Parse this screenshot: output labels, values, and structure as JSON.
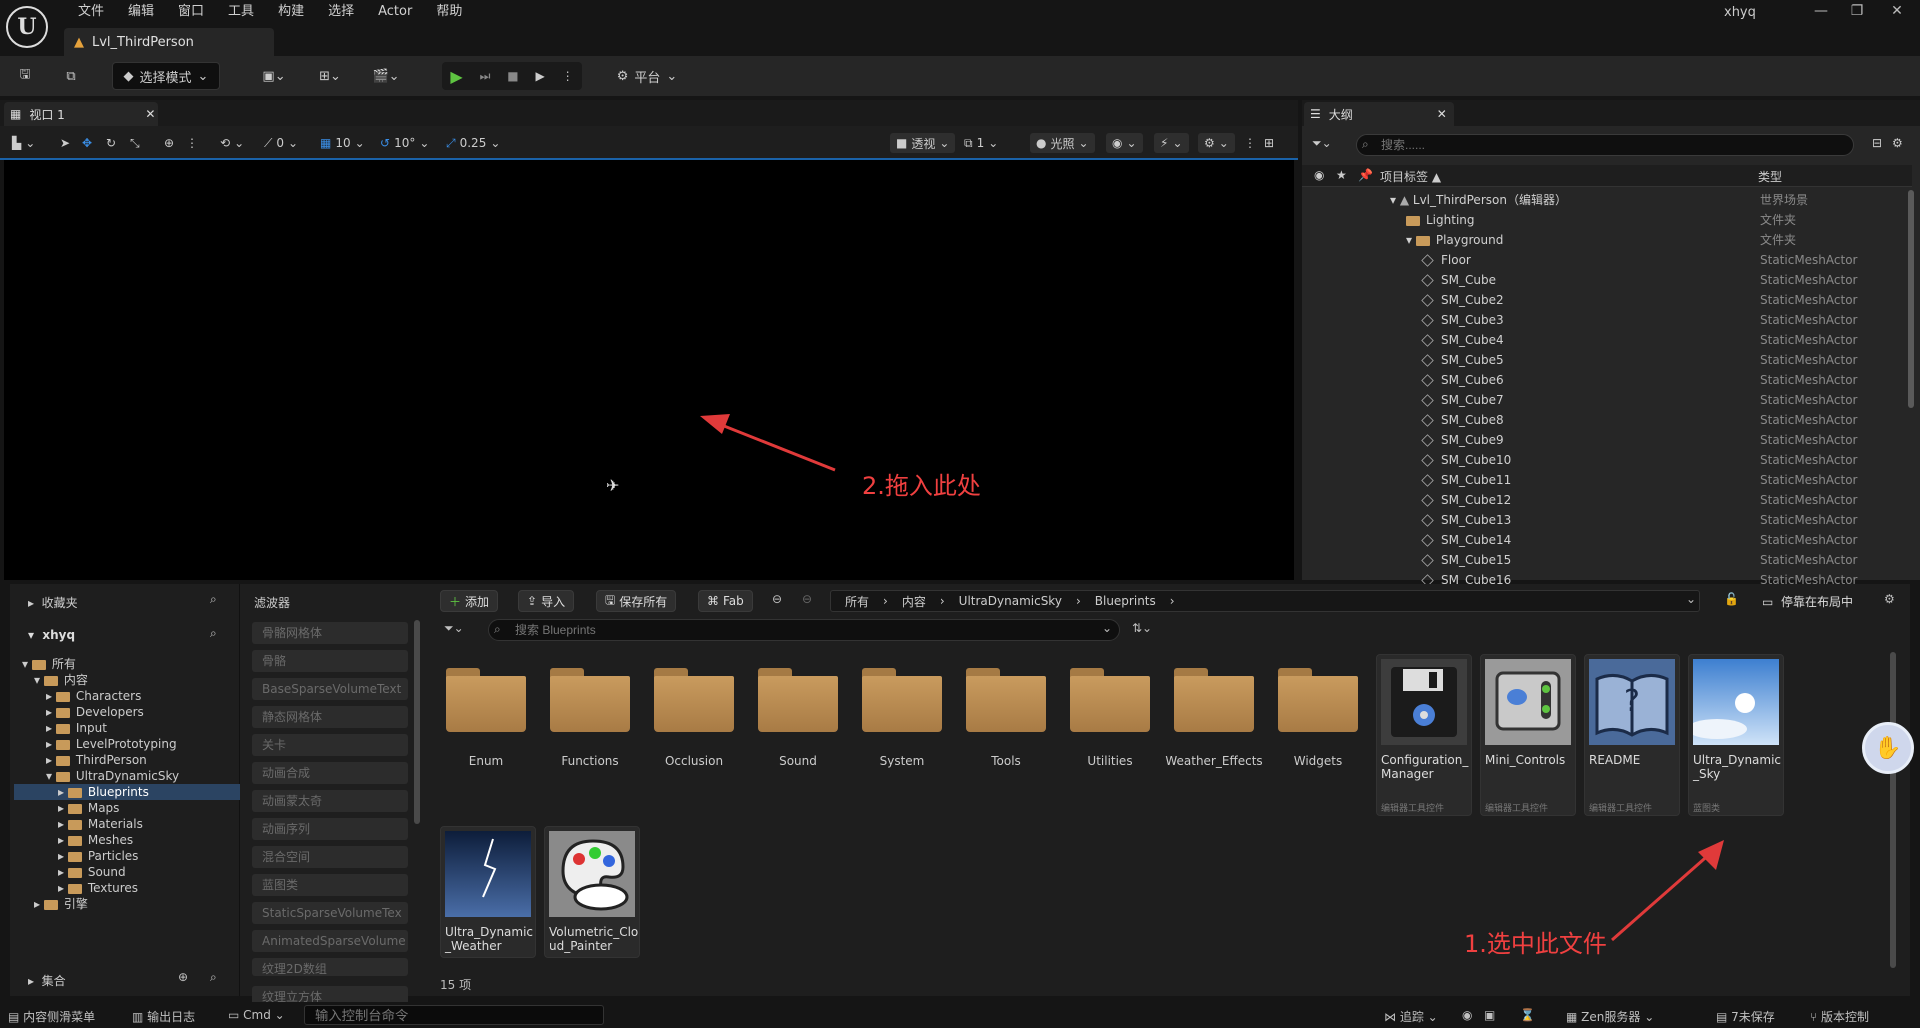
{
  "menu": [
    "文件",
    "编辑",
    "窗口",
    "工具",
    "构建",
    "选择",
    "Actor",
    "帮助"
  ],
  "level_tab": "Lvl_ThirdPerson",
  "user": "xhyq",
  "toolbar": {
    "mode": "选择模式",
    "platform": "平台"
  },
  "viewport": {
    "tab": "视口 1",
    "perspective": "透视",
    "lighting": "光照",
    "grid": "10",
    "rot": "10°",
    "scale": "0.25",
    "one": "1",
    "zero": "0"
  },
  "annotations": {
    "a1": "1.选中此文件",
    "a2": "2.拖入此处"
  },
  "outliner": {
    "tab": "大纲",
    "search": "搜索......",
    "col_label": "项目标签",
    "col_type": "类型",
    "rows": [
      {
        "name": "Lvl_ThirdPerson（编辑器）",
        "type": "世界场景",
        "indent": 0,
        "kind": "level"
      },
      {
        "name": "Lighting",
        "type": "文件夹",
        "indent": 1,
        "kind": "folder"
      },
      {
        "name": "Playground",
        "type": "文件夹",
        "indent": 1,
        "kind": "folder"
      },
      {
        "name": "Floor",
        "type": "StaticMeshActor",
        "indent": 2,
        "kind": "mesh"
      },
      {
        "name": "SM_Cube",
        "type": "StaticMeshActor",
        "indent": 2,
        "kind": "mesh"
      },
      {
        "name": "SM_Cube2",
        "type": "StaticMeshActor",
        "indent": 2,
        "kind": "mesh"
      },
      {
        "name": "SM_Cube3",
        "type": "StaticMeshActor",
        "indent": 2,
        "kind": "mesh"
      },
      {
        "name": "SM_Cube4",
        "type": "StaticMeshActor",
        "indent": 2,
        "kind": "mesh"
      },
      {
        "name": "SM_Cube5",
        "type": "StaticMeshActor",
        "indent": 2,
        "kind": "mesh"
      },
      {
        "name": "SM_Cube6",
        "type": "StaticMeshActor",
        "indent": 2,
        "kind": "mesh"
      },
      {
        "name": "SM_Cube7",
        "type": "StaticMeshActor",
        "indent": 2,
        "kind": "mesh"
      },
      {
        "name": "SM_Cube8",
        "type": "StaticMeshActor",
        "indent": 2,
        "kind": "mesh"
      },
      {
        "name": "SM_Cube9",
        "type": "StaticMeshActor",
        "indent": 2,
        "kind": "mesh"
      },
      {
        "name": "SM_Cube10",
        "type": "StaticMeshActor",
        "indent": 2,
        "kind": "mesh"
      },
      {
        "name": "SM_Cube11",
        "type": "StaticMeshActor",
        "indent": 2,
        "kind": "mesh"
      },
      {
        "name": "SM_Cube12",
        "type": "StaticMeshActor",
        "indent": 2,
        "kind": "mesh"
      },
      {
        "name": "SM_Cube13",
        "type": "StaticMeshActor",
        "indent": 2,
        "kind": "mesh"
      },
      {
        "name": "SM_Cube14",
        "type": "StaticMeshActor",
        "indent": 2,
        "kind": "mesh"
      },
      {
        "name": "SM_Cube15",
        "type": "StaticMeshActor",
        "indent": 2,
        "kind": "mesh"
      },
      {
        "name": "SM_Cube16",
        "type": "StaticMeshActor",
        "indent": 2,
        "kind": "mesh"
      }
    ]
  },
  "cb": {
    "favorites": "收藏夹",
    "project": "xhyq",
    "collections": "集合",
    "filters_title": "滤波器",
    "tree": [
      {
        "label": "所有",
        "indent": 0
      },
      {
        "label": "内容",
        "indent": 1
      },
      {
        "label": "Characters",
        "indent": 2
      },
      {
        "label": "Developers",
        "indent": 2
      },
      {
        "label": "Input",
        "indent": 2
      },
      {
        "label": "LevelPrototyping",
        "indent": 2
      },
      {
        "label": "ThirdPerson",
        "indent": 2
      },
      {
        "label": "UltraDynamicSky",
        "indent": 2
      },
      {
        "label": "Blueprints",
        "indent": 3,
        "selected": true
      },
      {
        "label": "Maps",
        "indent": 3
      },
      {
        "label": "Materials",
        "indent": 3
      },
      {
        "label": "Meshes",
        "indent": 3
      },
      {
        "label": "Particles",
        "indent": 3
      },
      {
        "label": "Sound",
        "indent": 3
      },
      {
        "label": "Textures",
        "indent": 3
      },
      {
        "label": "引擎",
        "indent": 1
      }
    ],
    "filters": [
      "骨骼网格体",
      "骨骼",
      "BaseSparseVolumeText",
      "静态网格体",
      "关卡",
      "动画合成",
      "动画蒙太奇",
      "动画序列",
      "混合空间",
      "蓝图类",
      "StaticSparseVolumeTex",
      "AnimatedSparseVolume",
      "纹理2D数组",
      "纹理立方体"
    ],
    "buttons": {
      "add": "添加",
      "import": "导入",
      "save_all": "保存所有",
      "fab": "Fab",
      "dock": "停靠在布局中"
    },
    "crumbs": [
      "所有",
      "内容",
      "UltraDynamicSky",
      "Blueprints"
    ],
    "search": "搜索 Blueprints",
    "folders": [
      "Enum",
      "Functions",
      "Occlusion",
      "Sound",
      "System",
      "Tools",
      "Utilities",
      "Weather_Effects",
      "Widgets"
    ],
    "assets": [
      {
        "name": "Configuration_Manager",
        "type": "编辑器工具控件",
        "style": "disk"
      },
      {
        "name": "Mini_Controls",
        "type": "编辑器工具控件",
        "style": "controls"
      },
      {
        "name": "README",
        "type": "编辑器工具控件",
        "style": "book"
      },
      {
        "name": "Ultra_Dynamic_Sky",
        "type": "蓝图类",
        "style": "sky"
      },
      {
        "name": "Ultra_Dynamic_Weather",
        "type": "",
        "style": "storm"
      },
      {
        "name": "Volumetric_Cloud_Painter",
        "type": "",
        "style": "palette"
      }
    ],
    "count": "15 项"
  },
  "status": {
    "drawer": "内容侧滑菜单",
    "log": "输出日志",
    "cmd": "Cmd",
    "cmd_placeholder": "输入控制台命令",
    "trace": "追踪",
    "zen": "Zen服务器",
    "unsaved": "7未保存",
    "vcs": "版本控制"
  }
}
